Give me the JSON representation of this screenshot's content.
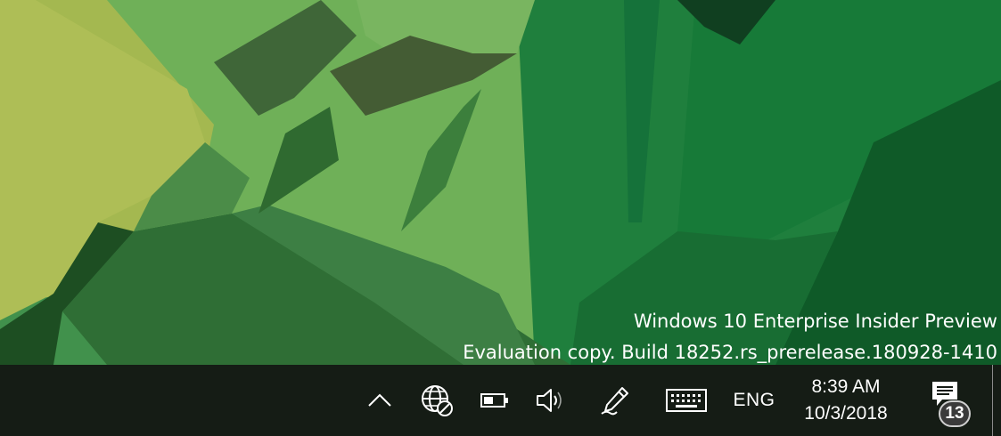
{
  "watermark": {
    "line1": "Windows 10 Enterprise Insider Preview",
    "line2": "Evaluation copy. Build 18252.rs_prerelease.180928-1410"
  },
  "taskbar": {
    "icons": {
      "overflow": "chevron-up-icon",
      "network": "globe-no-connection-icon",
      "battery": "battery-icon",
      "volume": "speaker-icon",
      "pen": "pen-workspace-icon",
      "keyboard": "touch-keyboard-icon",
      "notifications": "action-center-icon"
    },
    "language": "ENG",
    "time": "8:39 AM",
    "date": "10/3/2018",
    "notification_count": "13"
  },
  "colors": {
    "taskbar_bg": "#151c15",
    "wallpaper_base": "#3f8f4a"
  }
}
